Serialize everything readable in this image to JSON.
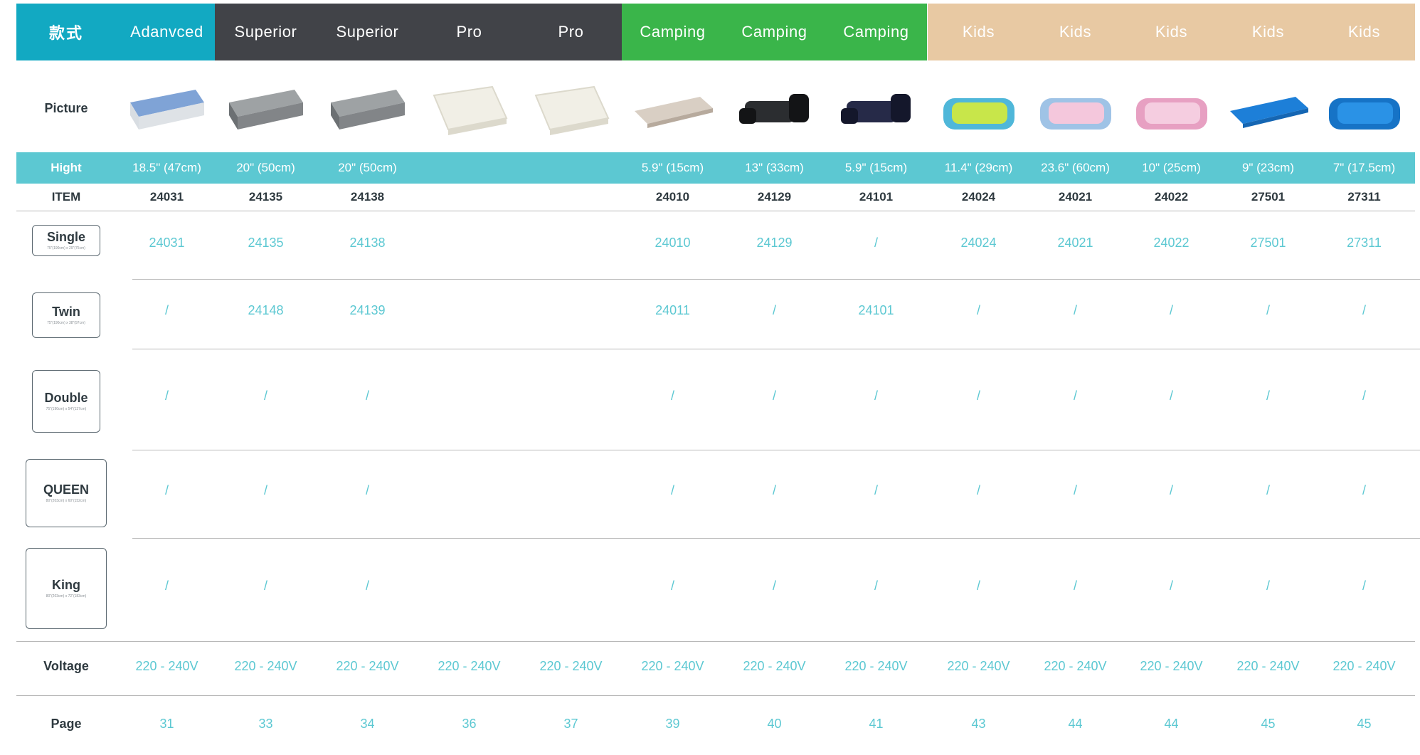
{
  "header": {
    "label": "款式",
    "label_bg": "#12a9c2",
    "columns": [
      {
        "name": "Adanvced",
        "bg": "#12a9c2"
      },
      {
        "name": "Superior",
        "bg": "#414348"
      },
      {
        "name": "Superior",
        "bg": "#414348"
      },
      {
        "name": "Pro",
        "bg": "#414348"
      },
      {
        "name": "Pro",
        "bg": "#414348"
      },
      {
        "name": "Camping",
        "bg": "#3ab54a"
      },
      {
        "name": "Camping",
        "bg": "#3ab54a"
      },
      {
        "name": "Camping",
        "bg": "#3ab54a"
      },
      {
        "name": "Kids",
        "bg": "#e8c9a3"
      },
      {
        "name": "Kids",
        "bg": "#e8c9a3"
      },
      {
        "name": "Kids",
        "bg": "#e8c9a3"
      },
      {
        "name": "Kids",
        "bg": "#e8c9a3"
      },
      {
        "name": "Kids",
        "bg": "#e8c9a3"
      }
    ]
  },
  "picture_row": {
    "label": "Picture",
    "images": [
      {
        "icon": "blue-flocked-airbed-image"
      },
      {
        "icon": "grey-raised-airbed-image"
      },
      {
        "icon": "grey-raised-airbed-image"
      },
      {
        "icon": "white-quilted-airbed-image"
      },
      {
        "icon": "white-quilted-airbed-image"
      },
      {
        "icon": "camping-mattress-with-person-image"
      },
      {
        "icon": "black-car-airbed-image"
      },
      {
        "icon": "navy-car-airbed-image"
      },
      {
        "icon": "green-dino-kids-bed-image"
      },
      {
        "icon": "pink-kids-bed-with-girl-image"
      },
      {
        "icon": "pink-kids-bed-with-child-image"
      },
      {
        "icon": "blue-kids-airbed-image"
      },
      {
        "icon": "blue-inflatable-kids-bed-image"
      }
    ]
  },
  "height_row": {
    "label": "Hight",
    "values": [
      "18.5\" (47cm)",
      "20\" (50cm)",
      "20\" (50cm)",
      "",
      "",
      "5.9\" (15cm)",
      "13\" (33cm)",
      "5.9\" (15cm)",
      "11.4\" (29cm)",
      "23.6\" (60cm)",
      "10\" (25cm)",
      "9\" (23cm)",
      "7\" (17.5cm)"
    ]
  },
  "item_row": {
    "label": "ITEM",
    "values": [
      "24031",
      "24135",
      "24138",
      "",
      "",
      "24010",
      "24129",
      "24101",
      "24024",
      "24021",
      "24022",
      "27501",
      "27311"
    ]
  },
  "sizes": [
    {
      "id": "single",
      "label": "Single",
      "dims": "75\"(190cm) x 29\"(75cm)",
      "values": [
        "24031",
        "24135",
        "24138",
        "",
        "",
        "24010",
        "24129",
        "/",
        "24024",
        "24021",
        "24022",
        "27501",
        "27311"
      ]
    },
    {
      "id": "twin",
      "label": "Twin",
      "dims": "75\"(190cm) x 38\"(97cm)",
      "values": [
        "/",
        "24148",
        "24139",
        "",
        "",
        "24011",
        "/",
        "24101",
        "/",
        "/",
        "/",
        "/",
        "/"
      ]
    },
    {
      "id": "double",
      "label": "Double",
      "dims": "75\"(190cm) x 54\"(137cm)",
      "values": [
        "/",
        "/",
        "/",
        "",
        "",
        "/",
        "/",
        "/",
        "/",
        "/",
        "/",
        "/",
        "/"
      ]
    },
    {
      "id": "queen",
      "label": "QUEEN",
      "dims": "80\"(203cm) x 60\"(152cm)",
      "values": [
        "/",
        "/",
        "/",
        "",
        "",
        "/",
        "/",
        "/",
        "/",
        "/",
        "/",
        "/",
        "/"
      ]
    },
    {
      "id": "king",
      "label": "King",
      "dims": "80\"(203cm) x 72\"(183cm)",
      "values": [
        "/",
        "/",
        "/",
        "",
        "",
        "/",
        "/",
        "/",
        "/",
        "/",
        "/",
        "/",
        "/"
      ]
    }
  ],
  "voltage_row": {
    "label": "Voltage",
    "values": [
      "220 - 240V",
      "220 - 240V",
      "220 - 240V",
      "220 - 240V",
      "220 - 240V",
      "220 - 240V",
      "220 - 240V",
      "220 - 240V",
      "220 - 240V",
      "220 - 240V",
      "220 - 240V",
      "220 - 240V",
      "220 - 240V"
    ]
  },
  "page_row": {
    "label": "Page",
    "values": [
      "31",
      "33",
      "34",
      "36",
      "37",
      "39",
      "40",
      "41",
      "43",
      "44",
      "44",
      "45",
      "45"
    ]
  },
  "colors": {
    "accent_teal": "#5cc8d2",
    "label_dark": "#2f3a40"
  }
}
